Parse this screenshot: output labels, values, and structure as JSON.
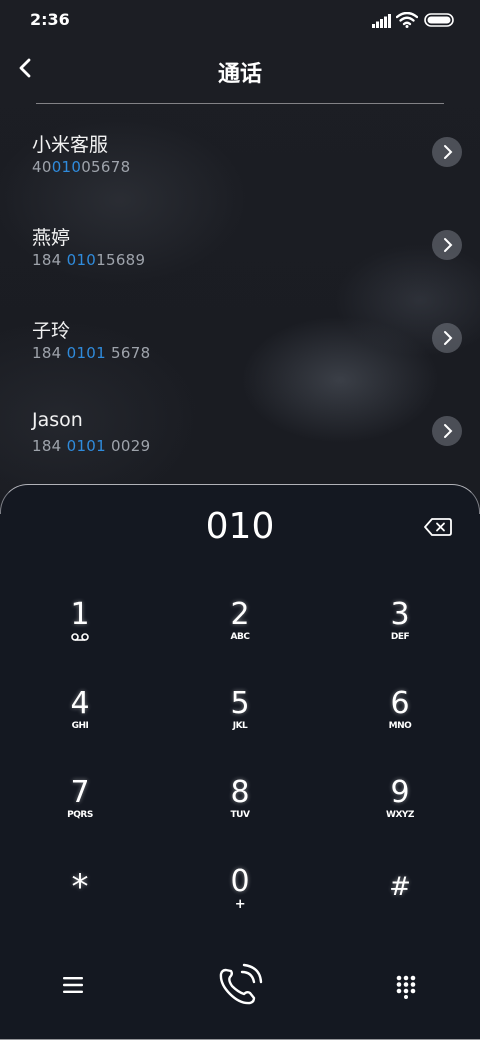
{
  "status_bar": {
    "time": "2:36"
  },
  "header": {
    "title": "通话"
  },
  "matches": [
    {
      "name": "小米客服",
      "pre": "40",
      "hl": "010",
      "post": "05678"
    },
    {
      "name": "燕婷",
      "pre": "184 ",
      "hl": "010",
      "post": "15689"
    },
    {
      "name": "子玲",
      "pre": "184 ",
      "hl": "0101",
      "post": " 5678"
    },
    {
      "name": "Jason",
      "pre": "184 ",
      "hl": "0101",
      "post": " 0029"
    }
  ],
  "dialpad": {
    "entered": "010",
    "keys": [
      {
        "digit": "1",
        "letters": ""
      },
      {
        "digit": "2",
        "letters": "ABC"
      },
      {
        "digit": "3",
        "letters": "DEF"
      },
      {
        "digit": "4",
        "letters": "GHI"
      },
      {
        "digit": "5",
        "letters": "JKL"
      },
      {
        "digit": "6",
        "letters": "MNO"
      },
      {
        "digit": "7",
        "letters": "PQRS"
      },
      {
        "digit": "8",
        "letters": "TUV"
      },
      {
        "digit": "9",
        "letters": "WXYZ"
      },
      {
        "digit": "*",
        "letters": ""
      },
      {
        "digit": "0",
        "letters": "+"
      },
      {
        "digit": "#",
        "letters": ""
      }
    ]
  },
  "icons": {
    "voicemail": "voicemail-icon",
    "backspace": "backspace-icon",
    "menu": "menu-icon",
    "call": "call-icon",
    "dialpad": "dialpad-icon"
  },
  "colors": {
    "highlight": "#2f8bdc",
    "pad_bg": "#141821"
  }
}
